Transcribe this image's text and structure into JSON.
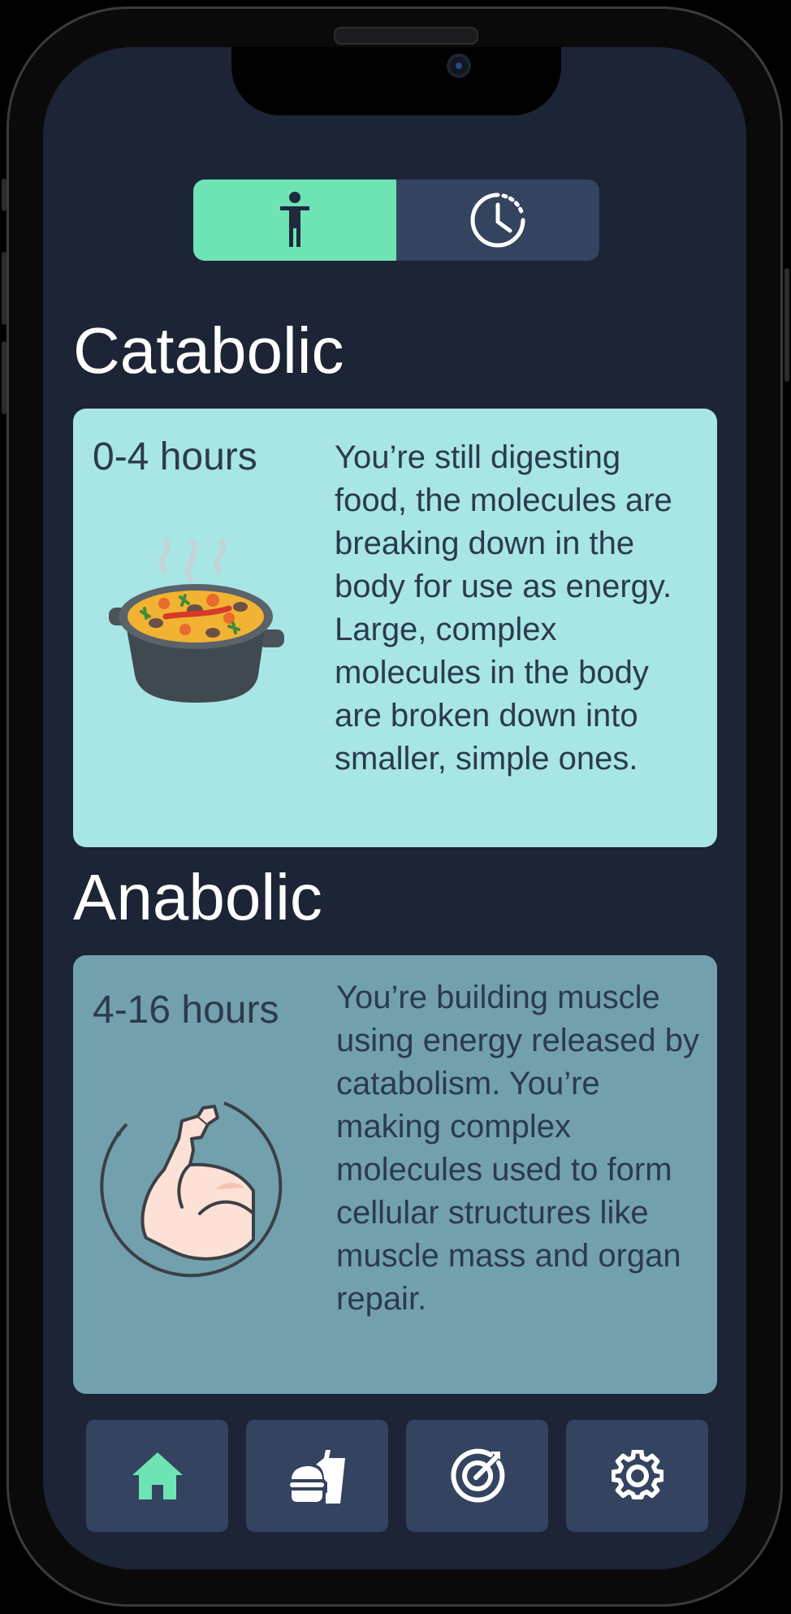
{
  "toggle": {
    "options": [
      {
        "icon": "person-icon",
        "active": true
      },
      {
        "icon": "clock-icon",
        "active": false
      }
    ],
    "active_color": "#6ee3b4",
    "inactive_color": "#34435f"
  },
  "sections": [
    {
      "title": "Catabolic",
      "hours": "0-4 hours",
      "description": "You’re still digesting food, the molecules are breaking down in the body for use as energy. Large, complex molecules in the body are broken down into smaller, simple ones.",
      "image": "food-pot-icon",
      "card_color": "#a7e6e4"
    },
    {
      "title": "Anabolic",
      "hours": "4-16 hours",
      "description": "You’re building muscle using energy released by catabolism. You’re making complex molecules used to form cellular structures like muscle mass and organ repair.",
      "image": "flexed-bicep-icon",
      "card_color": "#72a1ad"
    }
  ],
  "nav": {
    "items": [
      {
        "icon": "home-icon",
        "active": true
      },
      {
        "icon": "food-drink-icon",
        "active": false
      },
      {
        "icon": "target-icon",
        "active": false
      },
      {
        "icon": "gear-icon",
        "active": false
      }
    ]
  },
  "colors": {
    "background": "#1c2436",
    "accent": "#6ee3b4",
    "button": "#34435f"
  }
}
